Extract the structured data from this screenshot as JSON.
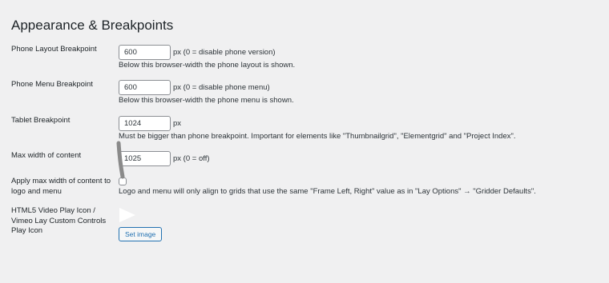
{
  "section": {
    "title": "Appearance & Breakpoints"
  },
  "rows": [
    {
      "label": "Phone Layout Breakpoint",
      "value": "600",
      "unit": "px (0 = disable phone version)",
      "description": "Below this browser-width the phone layout is shown."
    },
    {
      "label": "Phone Menu Breakpoint",
      "value": "600",
      "unit": "px (0 = disable phone menu)",
      "description": "Below this browser-width the phone menu is shown."
    },
    {
      "label": "Tablet Breakpoint",
      "value": "1024",
      "unit": "px",
      "description": "Must be bigger than phone breakpoint. Important for elements like \"Thumbnailgrid\", \"Elementgrid\" and \"Project Index\"."
    },
    {
      "label": "Max width of content",
      "value": "1025",
      "unit": "px (0 = off)"
    }
  ],
  "max_width_logo_menu": {
    "label": "Apply max width of content to logo and menu",
    "checked": false,
    "description": "Logo and menu will only align to grids that use the same \"Frame Left, Right\" value as in \"Lay Options\" → \"Gridder Defaults\"."
  },
  "play_icon": {
    "label": "HTML5 Video Play Icon / Vimeo Lay Custom Controls Play Icon",
    "button_label": "Set image"
  },
  "colors": {
    "background": "#f0f0f1",
    "text": "#1d2327",
    "input_border": "#8c8f94",
    "button_accent": "#2271b1",
    "play_icon_fill": "#ffffff",
    "cursor_stroke": "#8a8a8a"
  }
}
